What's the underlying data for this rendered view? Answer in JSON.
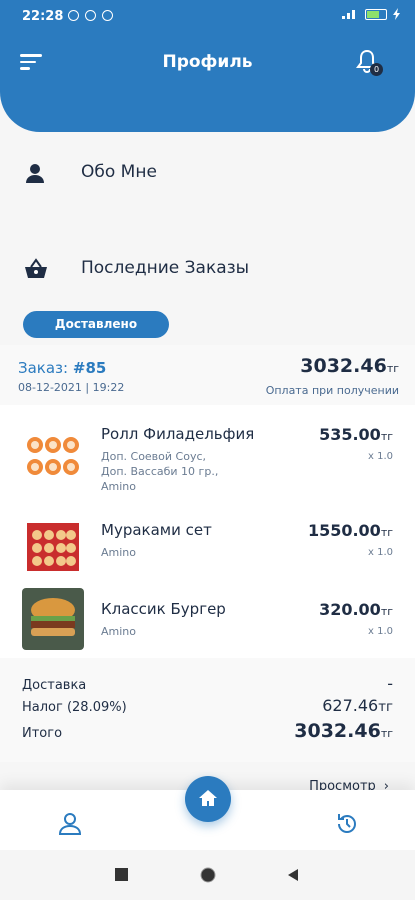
{
  "status_bar": {
    "time": "22:28",
    "battery_color": "#8ee06c"
  },
  "colors": {
    "primary": "#2b7bbf",
    "text_dark": "#1f2d44"
  },
  "header": {
    "title": "Профиль",
    "notifications": {
      "icon": "bell-icon",
      "count": "0"
    }
  },
  "menu": [
    {
      "label": "Обо Мне",
      "icon": "user-icon"
    },
    {
      "label": "Последние Заказы",
      "icon": "basket-icon"
    }
  ],
  "order": {
    "status": "Доставлено",
    "number_label": "Заказ:",
    "number": "#85",
    "date": "08-12-2021 | 19:22",
    "total": "3032.46",
    "currency": "тг",
    "payment": "Оплата при получении",
    "items": [
      {
        "name": "Ролл Филадельфия",
        "desc": [
          "Доп. Соевой Соус,",
          "Доп. Вассаби 10 гр.,",
          "Amino"
        ],
        "price": "535.00",
        "currency": "тг",
        "qty": "x 1.0"
      },
      {
        "name": "Мураками сет",
        "desc": [
          "Amino"
        ],
        "price": "1550.00",
        "currency": "тг",
        "qty": "x 1.0"
      },
      {
        "name": "Классик Бургер",
        "desc": [
          "Amino"
        ],
        "price": "320.00",
        "currency": "тг",
        "qty": "x 1.0"
      }
    ],
    "summary": {
      "delivery_label": "Доставка",
      "delivery_value": "-",
      "tax_label": "Налог (28.09%)",
      "tax_value": "627.46",
      "tax_currency": "тг",
      "total_label": "Итого",
      "total_value": "3032.46",
      "total_currency": "тг"
    },
    "more": "Просмотр"
  },
  "bottom_nav": [
    "profile-icon",
    "home-icon",
    "history-icon"
  ]
}
